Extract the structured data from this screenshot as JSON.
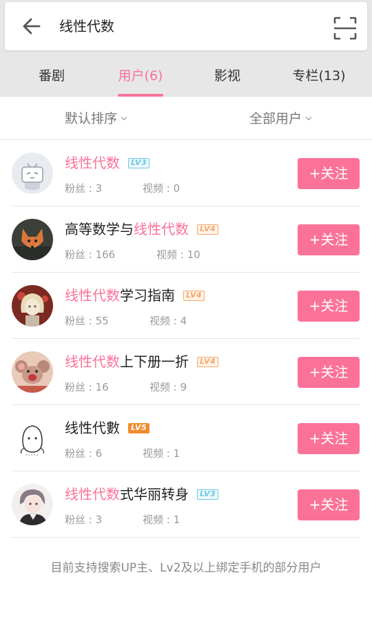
{
  "search": {
    "query": "线性代数"
  },
  "tabs": [
    {
      "label": "番剧"
    },
    {
      "label": "用户(6)"
    },
    {
      "label": "影视"
    },
    {
      "label": "专栏(13)"
    }
  ],
  "active_tab": "用户(6)",
  "filters": {
    "sort": "默认排序",
    "user_type": "全部用户"
  },
  "accent_color": "#fb7299",
  "users": [
    {
      "name_highlight": "线性代数",
      "name_rest": "",
      "level": "LV3",
      "fans_label": "粉丝 : 3",
      "videos_label": "视频 : 0",
      "follow_label": "+关注",
      "avatar": "default-tv-avatar"
    },
    {
      "name_prefix": "高等数学与",
      "name_highlight": "线性代数",
      "name_rest": "",
      "level": "LV4",
      "fans_label": "粉丝 : 166",
      "videos_label": "视频 : 10",
      "follow_label": "+关注",
      "avatar": "fox-avatar"
    },
    {
      "name_highlight": "线性代数",
      "name_rest": "学习指南",
      "level": "LV4",
      "fans_label": "粉丝 : 55",
      "videos_label": "视频 : 4",
      "follow_label": "+关注",
      "avatar": "anime-girl-avatar"
    },
    {
      "name_highlight": "线性代数",
      "name_rest": "上下册一折",
      "level": "LV4",
      "fans_label": "粉丝 : 16",
      "videos_label": "视频 : 9",
      "follow_label": "+关注",
      "avatar": "cartoon-mouse-avatar"
    },
    {
      "name_plain": "线性代數",
      "level": "LV5",
      "fans_label": "粉丝 : 6",
      "videos_label": "视频 : 1",
      "follow_label": "+关注",
      "avatar": "potato-sketch-avatar"
    },
    {
      "name_highlight": "线性代数",
      "name_rest": "式华丽转身",
      "level": "LV3",
      "fans_label": "粉丝 : 3",
      "videos_label": "视频 : 1",
      "follow_label": "+关注",
      "avatar": "anime-boy-avatar"
    }
  ],
  "footer_note": "目前支持搜索UP主、Lv2及以上绑定手机的部分用户"
}
